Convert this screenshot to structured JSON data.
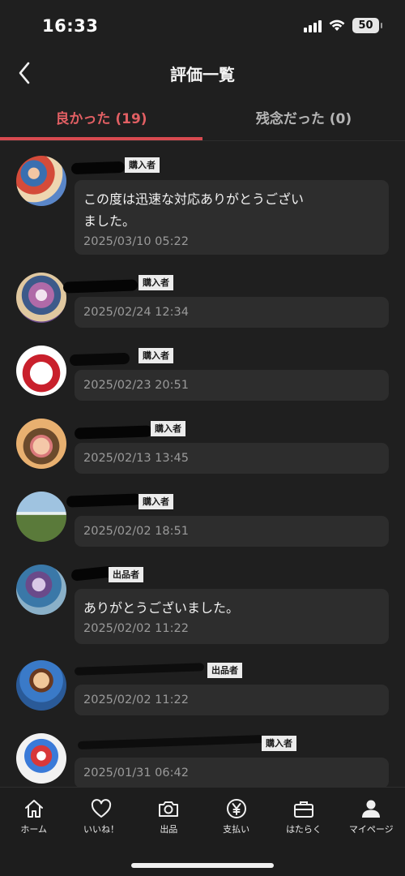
{
  "status_bar": {
    "time": "16:33",
    "battery": "50"
  },
  "header": {
    "title": "評価一覧"
  },
  "tabs": [
    {
      "label": "良かった (19)",
      "active": true
    },
    {
      "label": "残念だった (0)",
      "active": false
    }
  ],
  "reviews": [
    {
      "role": "購入者",
      "comment": "この度は迅速な対応ありがとうござい\nました。",
      "date": "2025/03/10 05:22"
    },
    {
      "role": "購入者",
      "comment": "",
      "date": "2025/02/24 12:34"
    },
    {
      "role": "購入者",
      "comment": "",
      "date": "2025/02/23 20:51"
    },
    {
      "role": "購入者",
      "comment": "",
      "date": "2025/02/13 13:45"
    },
    {
      "role": "購入者",
      "comment": "",
      "date": "2025/02/02 18:51"
    },
    {
      "role": "出品者",
      "comment": "ありがとうございました。",
      "date": "2025/02/02 11:22"
    },
    {
      "role": "出品者",
      "comment": "",
      "date": "2025/02/02 11:22"
    },
    {
      "role": "購入者",
      "comment": "",
      "date": "2025/01/31 06:42"
    }
  ],
  "bottom_nav": [
    {
      "label": "ホーム",
      "icon": "home-icon"
    },
    {
      "label": "いいね！",
      "icon": "heart-icon"
    },
    {
      "label": "出品",
      "icon": "camera-icon"
    },
    {
      "label": "支払い",
      "icon": "yen-icon"
    },
    {
      "label": "はたらく",
      "icon": "briefcase-icon"
    },
    {
      "label": "マイページ",
      "icon": "person-icon"
    }
  ],
  "colors": {
    "accent": "#d84a50",
    "background": "#1f1f1f",
    "bubble": "#2d2d2d"
  }
}
